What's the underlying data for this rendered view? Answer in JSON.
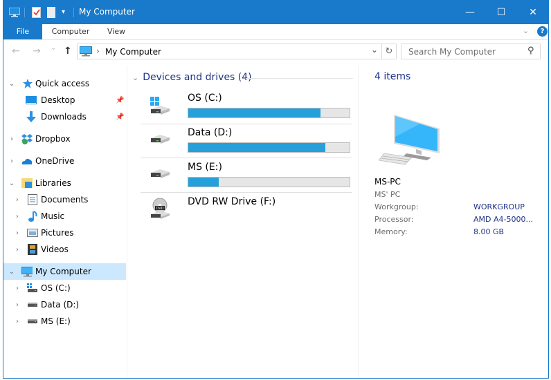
{
  "window": {
    "title": "My Computer",
    "minimize_label": "—",
    "maximize_label": "☐",
    "close_label": "✕"
  },
  "ribbon": {
    "tabs": [
      {
        "label": "File"
      },
      {
        "label": "Computer"
      },
      {
        "label": "View"
      }
    ],
    "help_label": "?"
  },
  "nav": {
    "back": "←",
    "forward": "→",
    "recent": "⌄",
    "up": "↑",
    "breadcrumb_sep": "›",
    "path": "My Computer",
    "dropdown": "⌄",
    "refresh": "↻",
    "search_placeholder": "Search My Computer",
    "search_icon": "⚲"
  },
  "sidebar": {
    "items": [
      {
        "label": "Quick access",
        "icon": "star-icon",
        "expanded": true
      },
      {
        "label": "Desktop",
        "icon": "desktop-icon",
        "pinned": true
      },
      {
        "label": "Downloads",
        "icon": "download-icon",
        "pinned": true
      },
      {
        "label": "Dropbox",
        "icon": "dropbox-icon"
      },
      {
        "label": "OneDrive",
        "icon": "onedrive-icon"
      },
      {
        "label": "Libraries",
        "icon": "libraries-icon",
        "expanded": true
      },
      {
        "label": "Documents",
        "icon": "documents-icon"
      },
      {
        "label": "Music",
        "icon": "music-icon"
      },
      {
        "label": "Pictures",
        "icon": "pictures-icon"
      },
      {
        "label": "Videos",
        "icon": "videos-icon"
      },
      {
        "label": "My Computer",
        "icon": "computer-icon",
        "expanded": true,
        "selected": true
      },
      {
        "label": "OS (C:)",
        "icon": "os-drive-icon"
      },
      {
        "label": "Data (D:)",
        "icon": "drive-icon"
      },
      {
        "label": "MS (E:)",
        "icon": "drive-icon"
      }
    ]
  },
  "content": {
    "group_title": "Devices and drives (4)",
    "drives": [
      {
        "name": "OS (C:)",
        "used_fraction": 0.82,
        "type": "os"
      },
      {
        "name": "Data (D:)",
        "used_fraction": 0.85,
        "type": "hdd"
      },
      {
        "name": "MS (E:)",
        "used_fraction": 0.19,
        "type": "hdd"
      },
      {
        "name": "DVD RW Drive (F:)",
        "type": "dvd"
      }
    ],
    "colors": {
      "bar_fill": "#26a0da",
      "bar_bg": "#e6e6e6",
      "header": "#1e3287"
    }
  },
  "details": {
    "count": "4 items",
    "computer_name": "MS-PC",
    "description": "MS' PC",
    "properties": [
      {
        "label": "Workgroup:",
        "value": "WORKGROUP"
      },
      {
        "label": "Processor:",
        "value": "AMD A4-5000..."
      },
      {
        "label": "Memory:",
        "value": "8.00 GB"
      }
    ]
  }
}
